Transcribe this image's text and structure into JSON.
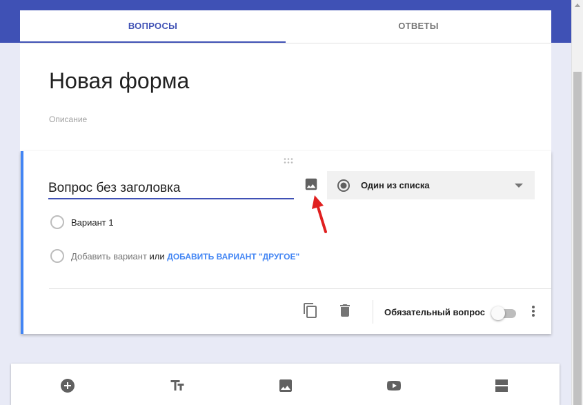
{
  "tabs": [
    {
      "label": "ВОПРОСЫ",
      "active": true
    },
    {
      "label": "ОТВЕТЫ",
      "active": false
    }
  ],
  "form": {
    "title": "Новая форма",
    "description_placeholder": "Описание"
  },
  "question": {
    "title": "Вопрос без заголовка",
    "type_label": "Один из списка",
    "options": [
      "Вариант 1"
    ],
    "add_option": "Добавить вариант",
    "or_text": "или",
    "add_other": "ДОБАВИТЬ ВАРИАНТ \"ДРУГОЕ\"",
    "required_label": "Обязательный вопрос",
    "required": false
  },
  "toolbar_icons": [
    "add-question-icon",
    "title-text-icon",
    "add-image-icon",
    "add-video-icon",
    "add-section-icon"
  ],
  "colors": {
    "primary": "#3f51b5",
    "accent": "#4285f4",
    "annotation_arrow": "#e02020"
  }
}
